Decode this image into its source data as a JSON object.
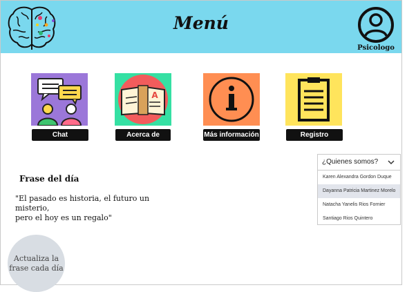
{
  "header": {
    "title": "Menú",
    "profile_label": "Psicologo",
    "logo_icon": "brain-icon",
    "profile_icon": "user-avatar-icon",
    "bg_color": "#7ad8ee"
  },
  "tiles": [
    {
      "label": "Chat",
      "icon": "chat-people-icon",
      "bg": "#9b77d9"
    },
    {
      "label": "Acerca de",
      "icon": "book-icon",
      "bg": "#35e0a3"
    },
    {
      "label": "Más información",
      "icon": "info-icon",
      "bg": "#ff8e52"
    },
    {
      "label": "Registro",
      "icon": "clipboard-icon",
      "bg": "#ffe45c"
    }
  ],
  "quote": {
    "title": "Frase del día",
    "line1": "\"El pasado es historia, el futuro un misterio,",
    "line2": "pero el hoy es un regalo\""
  },
  "refresh_button": {
    "line1": "Actualiza la",
    "line2": "frase cada día"
  },
  "dropdown": {
    "selected": "¿Quienes somos?",
    "options": [
      "Karen Alexandra Gordon Duque",
      "Dayanna Patricia Martinez Morelo",
      "Natacha Yanelis Rios Fornier",
      "Santiago Rios Quintero"
    ]
  }
}
